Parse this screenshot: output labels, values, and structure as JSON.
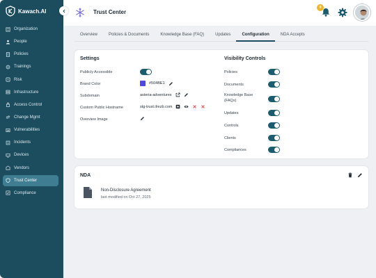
{
  "brand": {
    "name": "Kawach.AI"
  },
  "sidebar": {
    "items": [
      {
        "label": "Organization",
        "icon": "organization-icon"
      },
      {
        "label": "People",
        "icon": "people-icon"
      },
      {
        "label": "Policies",
        "icon": "policies-icon"
      },
      {
        "label": "Trainings",
        "icon": "trainings-icon"
      },
      {
        "label": "Risk",
        "icon": "risk-icon"
      },
      {
        "label": "Infrastructure",
        "icon": "infrastructure-icon"
      },
      {
        "label": "Access Control",
        "icon": "access-control-icon"
      },
      {
        "label": "Change Mgmt",
        "icon": "change-mgmt-icon"
      },
      {
        "label": "Vulnerabilities",
        "icon": "vulnerabilities-icon"
      },
      {
        "label": "Incidents",
        "icon": "incidents-icon"
      },
      {
        "label": "Devices",
        "icon": "devices-icon"
      },
      {
        "label": "Vendors",
        "icon": "vendors-icon"
      },
      {
        "label": "Trust Center",
        "icon": "trust-center-icon",
        "active": true
      },
      {
        "label": "Compliance",
        "icon": "compliance-icon"
      }
    ]
  },
  "header": {
    "title": "Trust Center",
    "notification_count": "9"
  },
  "tabs": [
    {
      "label": "Overview"
    },
    {
      "label": "Policies & Documents"
    },
    {
      "label": "Knowledge Base (FAQ)"
    },
    {
      "label": "Updates"
    },
    {
      "label": "Configuration",
      "active": true
    },
    {
      "label": "NDA Accepts"
    }
  ],
  "settings": {
    "title": "Settings",
    "publicly_accessible_label": "Publicly Accessible",
    "brand_color_label": "Brand Color",
    "brand_color_value": "#504BE1",
    "subdomain_label": "Subdomain",
    "subdomain_value": "asteria-adventures",
    "custom_hostname_label": "Custom Public Hostname",
    "custom_hostname_value": "stg-trust.ilrezb.com",
    "overview_image_label": "Overview Image"
  },
  "visibility": {
    "title": "Visibility Controls",
    "items": [
      {
        "label": "Policies",
        "on": true
      },
      {
        "label": "Documents",
        "on": true
      },
      {
        "label": "Knowledge Base (FAQs)",
        "on": true
      },
      {
        "label": "Updates",
        "on": true
      },
      {
        "label": "Controls",
        "on": true
      },
      {
        "label": "Clients",
        "on": true
      },
      {
        "label": "Compliances",
        "on": true
      }
    ]
  },
  "nda": {
    "title": "NDA",
    "doc_title": "Non-Disclosure Agreement",
    "doc_meta": "last modified on Oct 27, 2025"
  },
  "colors": {
    "sidebar": "#1b4d5f",
    "accent": "#1b5d6f",
    "brand_swatch": "#5048e5",
    "danger": "#d64545"
  }
}
